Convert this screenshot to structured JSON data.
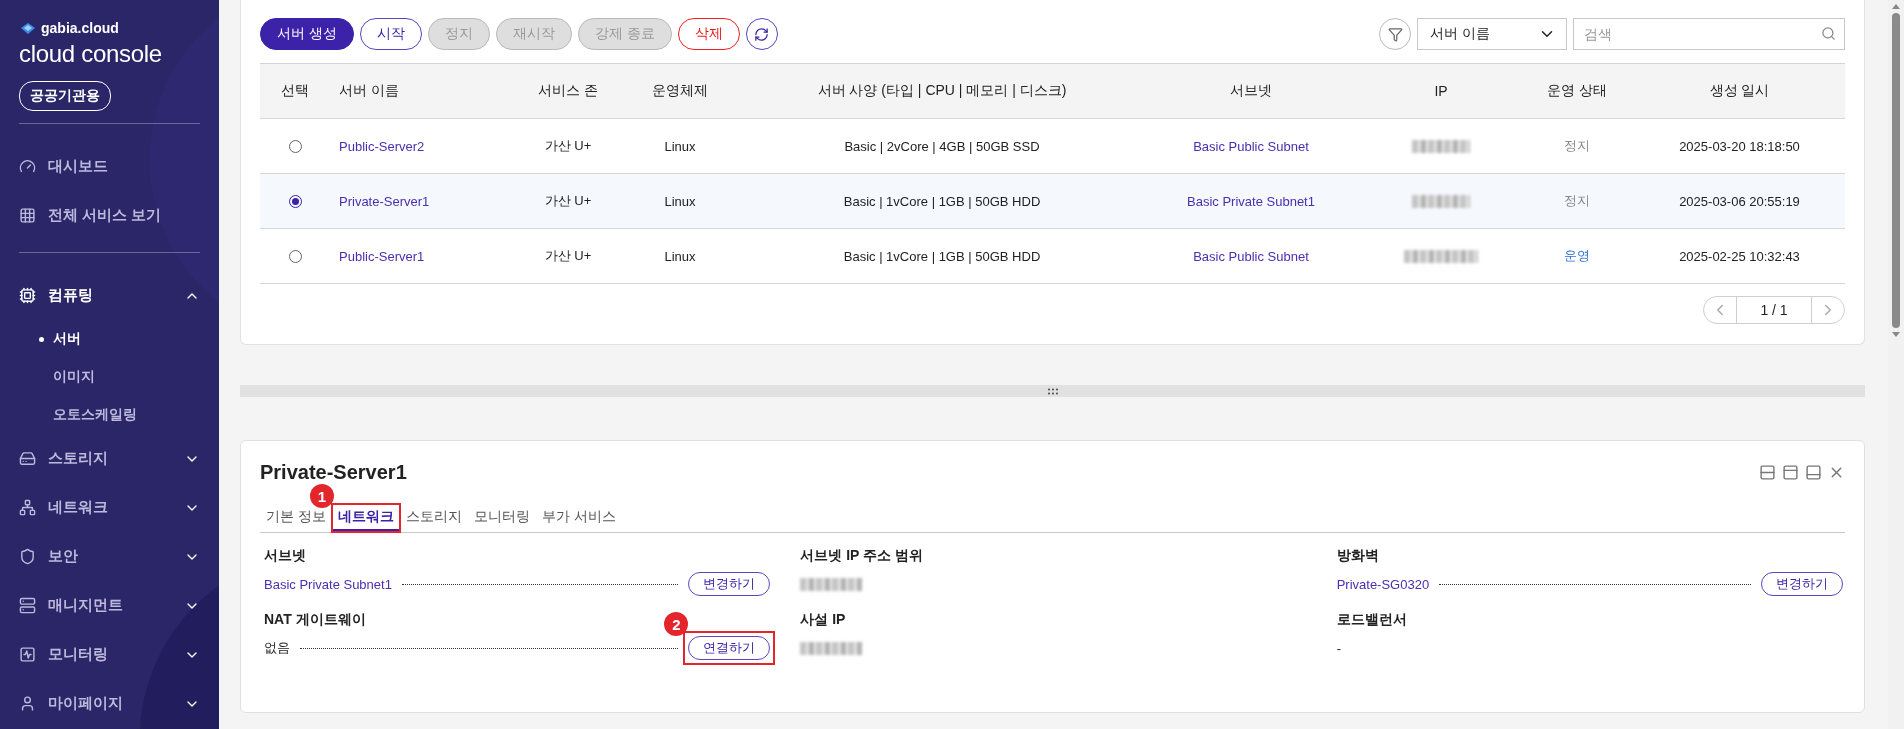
{
  "sidebar": {
    "brand": "gabia.cloud",
    "product": "cloud console",
    "badge": "공공기관용",
    "groups": [
      [
        {
          "label": "대시보드"
        },
        {
          "label": "전체 서비스 보기"
        }
      ],
      [
        {
          "label": "컴퓨팅",
          "expanded": true,
          "children": [
            {
              "label": "서버",
              "selected": true
            },
            {
              "label": "이미지",
              "selected": false
            },
            {
              "label": "오토스케일링",
              "selected": false
            }
          ]
        },
        {
          "label": "스토리지",
          "expanded": false
        },
        {
          "label": "네트워크",
          "expanded": false
        },
        {
          "label": "보안",
          "expanded": false
        },
        {
          "label": "매니지먼트",
          "expanded": false
        },
        {
          "label": "모니터링",
          "expanded": false
        },
        {
          "label": "마이페이지",
          "expanded": false
        }
      ]
    ]
  },
  "toolbar": {
    "buttons": [
      {
        "label": "서버 생성",
        "kind": "primary",
        "disabled": false
      },
      {
        "label": "시작",
        "kind": "outline",
        "disabled": false
      },
      {
        "label": "정지",
        "kind": "outline",
        "disabled": true
      },
      {
        "label": "재시작",
        "kind": "outline",
        "disabled": true
      },
      {
        "label": "강제 종료",
        "kind": "outline",
        "disabled": true
      },
      {
        "label": "삭제",
        "kind": "danger",
        "disabled": false
      }
    ],
    "filter_select": "서버 이름",
    "search": {
      "placeholder": "검색"
    }
  },
  "table": {
    "columns": [
      "선택",
      "서버 이름",
      "서비스 존",
      "운영체제",
      "서버 사양 (타입 | CPU | 메모리 | 디스크)",
      "서브넷",
      "IP",
      "운영 상태",
      "생성 일시"
    ],
    "rows": [
      {
        "selected": false,
        "name": "Public-Server2",
        "zone": "가산 U+",
        "os": "Linux",
        "spec": "Basic | 2vCore | 4GB | 50GB SSD",
        "subnet": "Basic Public Subnet",
        "status": {
          "text": "정지",
          "kind": "stopped"
        },
        "created": "2025-03-20 18:18:50"
      },
      {
        "selected": true,
        "name": "Private-Server1",
        "zone": "가산 U+",
        "os": "Linux",
        "spec": "Basic | 1vCore | 1GB | 50GB HDD",
        "subnet": "Basic Private Subnet1",
        "status": {
          "text": "정지",
          "kind": "stopped"
        },
        "created": "2025-03-06 20:55:19"
      },
      {
        "selected": false,
        "name": "Public-Server1",
        "zone": "가산 U+",
        "os": "Linux",
        "spec": "Basic | 1vCore | 1GB | 50GB HDD",
        "subnet": "Basic Public Subnet",
        "status": {
          "text": "운영",
          "kind": "running"
        },
        "created": "2025-02-25 10:32:43"
      }
    ],
    "pagination": "1 / 1"
  },
  "detail": {
    "title": "Private-Server1",
    "tabs": [
      {
        "label": "기본 정보",
        "selected": false
      },
      {
        "label": "네트워크",
        "selected": true,
        "callout": "1"
      },
      {
        "label": "스토리지",
        "selected": false
      },
      {
        "label": "모니터링",
        "selected": false
      },
      {
        "label": "부가 서비스",
        "selected": false
      }
    ],
    "columns": [
      [
        {
          "label": "서브넷",
          "kind": "link",
          "value": "Basic Private Subnet1",
          "action": "변경하기"
        },
        {
          "label": "NAT 게이트웨이",
          "kind": "text",
          "value": "없음",
          "action": "연결하기",
          "callout": "2"
        }
      ],
      [
        {
          "label": "서브넷 IP 주소 범위",
          "kind": "redacted"
        },
        {
          "label": "사설 IP",
          "kind": "redacted"
        }
      ],
      [
        {
          "label": "방화벽",
          "kind": "link",
          "value": "Private-SG0320",
          "action": "변경하기"
        },
        {
          "label": "로드밸런서",
          "kind": "text",
          "value": "-"
        }
      ]
    ]
  }
}
